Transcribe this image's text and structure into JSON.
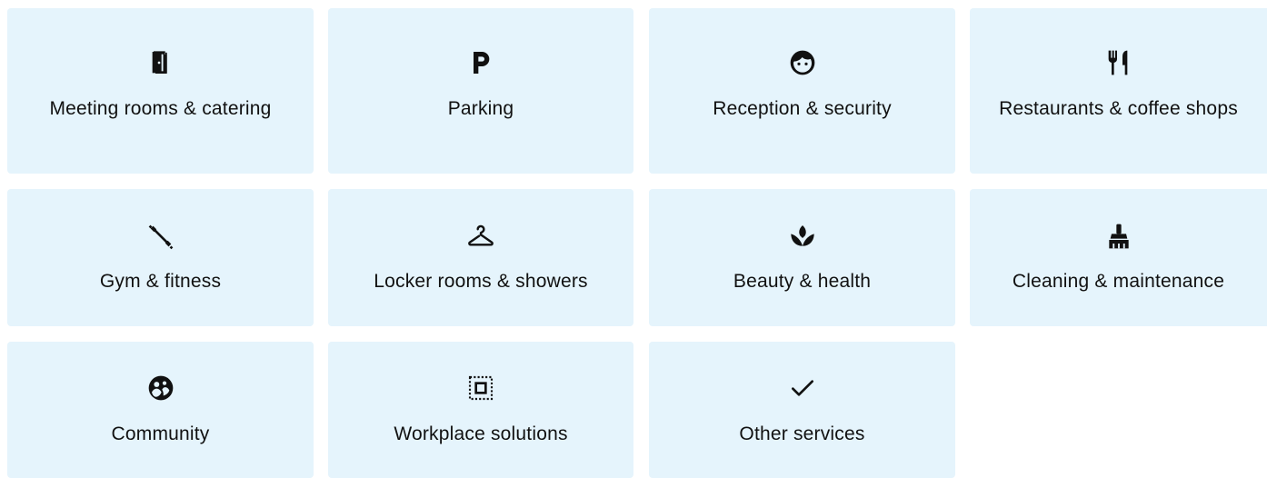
{
  "services": [
    {
      "label": "Meeting rooms & catering",
      "icon": "door-icon"
    },
    {
      "label": "Parking",
      "icon": "parking-icon"
    },
    {
      "label": "Reception & security",
      "icon": "face-icon"
    },
    {
      "label": "Restaurants & coffee shops",
      "icon": "fork-knife-icon"
    },
    {
      "label": "Gym & fitness",
      "icon": "dumbbell-icon"
    },
    {
      "label": "Locker rooms & showers",
      "icon": "hanger-icon"
    },
    {
      "label": "Beauty & health",
      "icon": "lotus-icon"
    },
    {
      "label": "Cleaning & maintenance",
      "icon": "broom-icon"
    },
    {
      "label": "Community",
      "icon": "community-icon"
    },
    {
      "label": "Workplace solutions",
      "icon": "select-square-icon"
    },
    {
      "label": "Other services",
      "icon": "check-icon"
    }
  ],
  "colors": {
    "card_background": "#e5f4fc",
    "text": "#111111",
    "page_background": "#ffffff"
  }
}
